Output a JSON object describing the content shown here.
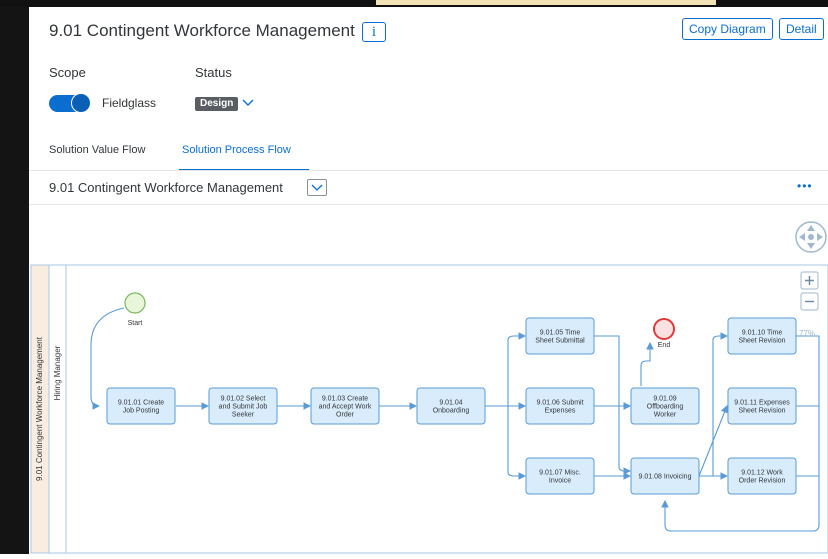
{
  "header": {
    "title": "9.01 Contingent Workforce Management",
    "info_label": "i",
    "copy_label": "Copy Diagram",
    "detail_label": "Detail"
  },
  "scope": {
    "label": "Scope",
    "toggle_label": "Fieldglass",
    "toggle_on": true
  },
  "status": {
    "label": "Status",
    "value": "Design"
  },
  "tabs": [
    {
      "label": "Solution Value Flow",
      "selected": false
    },
    {
      "label": "Solution Process Flow",
      "selected": true
    }
  ],
  "subbar": {
    "title": "9.01 Contingent Workforce Management",
    "more_icon": "overflow-dots-icon"
  },
  "diagram": {
    "pool_label": "9.01 Contingent Workforce Management",
    "lane_label": "Hiring Manager",
    "zoom": "77%",
    "start_label": "Start",
    "end_label": "End",
    "steps": {
      "s0101": [
        "9.01.01 Create",
        "Job Posting"
      ],
      "s0102": [
        "9.01.02 Select",
        "and Submit Job",
        "Seeker"
      ],
      "s0103": [
        "9.01.03 Create",
        "and Accept Work",
        "Order"
      ],
      "s0104": [
        "9.01.04",
        "Onboarding"
      ],
      "s0105": [
        "9.01.05 Time",
        "Sheet Submittal"
      ],
      "s0106": [
        "9.01.06 Submit",
        "Expenses"
      ],
      "s0107": [
        "9.01.07 Misc.",
        "Invoice"
      ],
      "s0108": [
        "9.01.08 Invoicing"
      ],
      "s0109": [
        "9.01.09",
        "Offboarding",
        "Worker"
      ],
      "s0110": [
        "9.01.10 Time",
        "Sheet Revision"
      ],
      "s0111": [
        "9.01.11 Expenses",
        "Sheet Revision"
      ],
      "s0112": [
        "9.01.12 Work",
        "Order Revision"
      ]
    }
  },
  "colors": {
    "accent": "#0a6ed1",
    "task_fill": "#d9ecfb",
    "task_stroke": "#5a9bd5",
    "start_fill": "#e8f6d9",
    "end_stroke": "#e03a3a",
    "pool_band": "#f9ece0"
  }
}
